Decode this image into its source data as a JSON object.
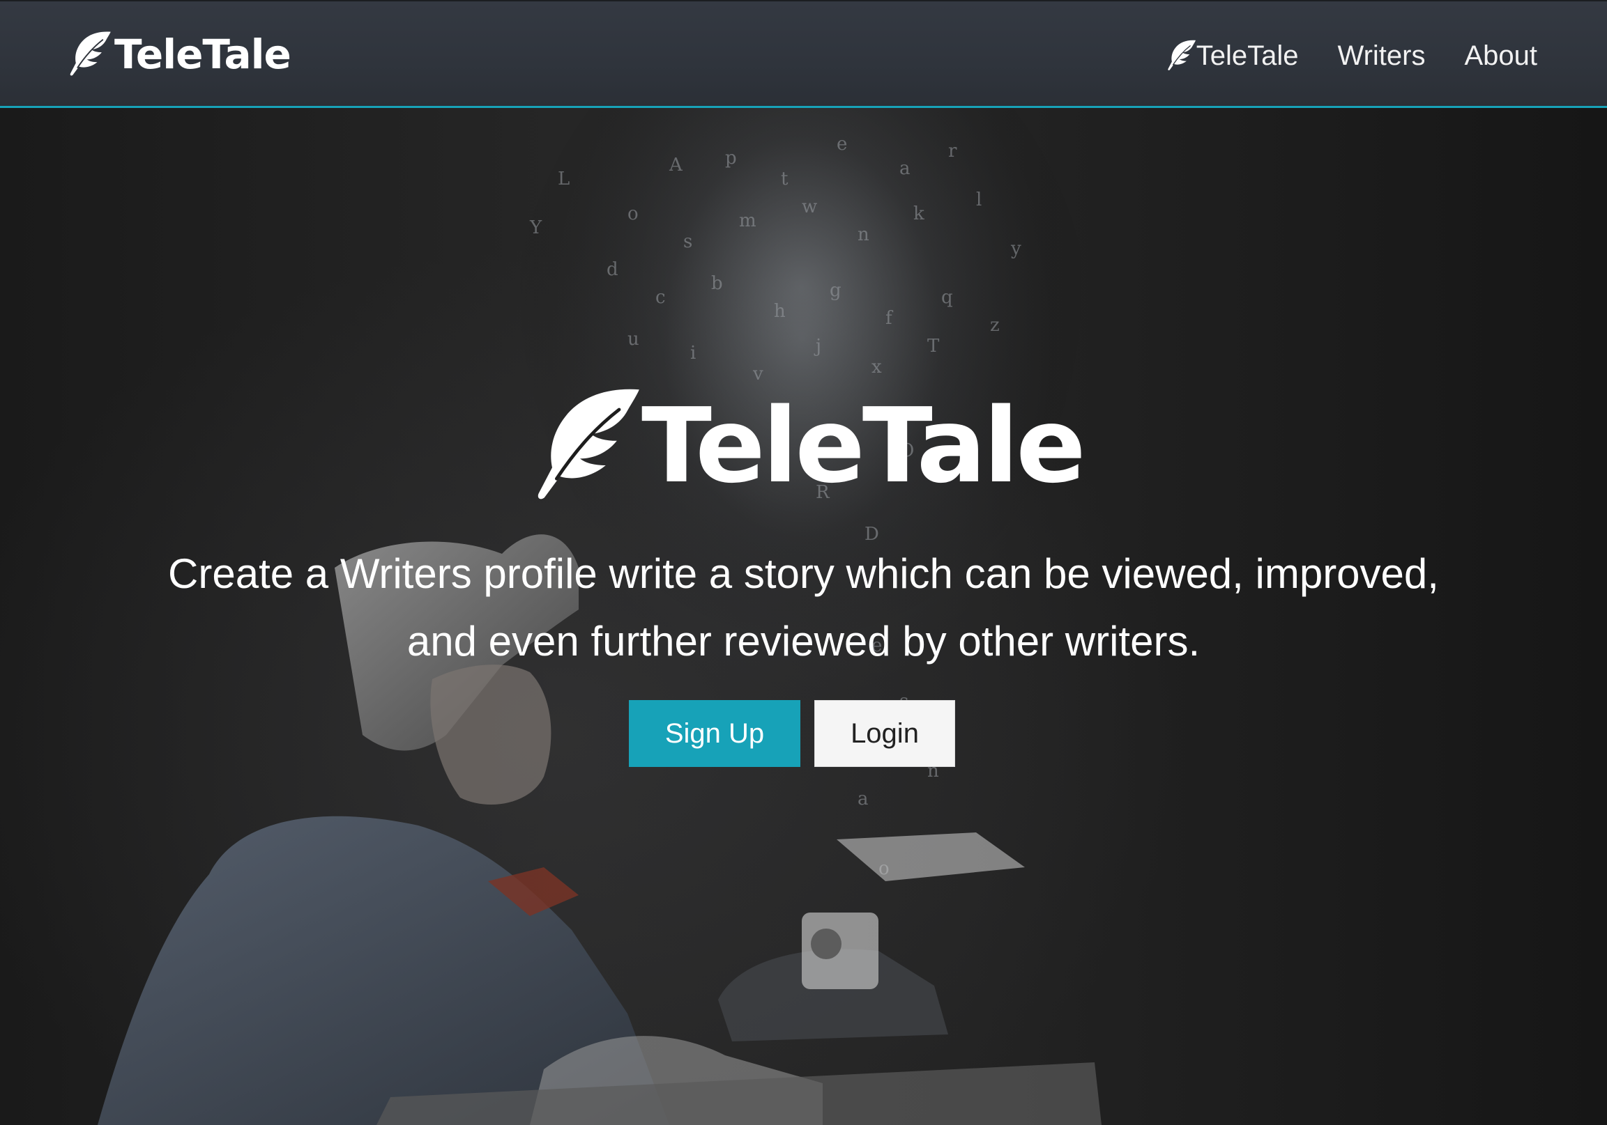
{
  "navbar": {
    "brand": {
      "icon": "feather-icon",
      "text": "TeleTale"
    },
    "links": [
      {
        "icon": "feather-icon",
        "label": "TeleTale"
      },
      {
        "label": "Writers"
      },
      {
        "label": "About"
      }
    ],
    "accent_color": "#17a2b8"
  },
  "hero": {
    "logo": {
      "icon": "feather-icon",
      "title": "TeleTale"
    },
    "tagline_line1": "Create a Writers profile write a story which can be viewed, improved,",
    "tagline_line2": "and even further reviewed by other writers.",
    "buttons": {
      "signup_label": "Sign Up",
      "login_label": "Login"
    },
    "background_image": "man-at-typewriter-with-floating-letters",
    "colors": {
      "signup": "#17a2b8",
      "login": "#f5f5f5"
    }
  }
}
